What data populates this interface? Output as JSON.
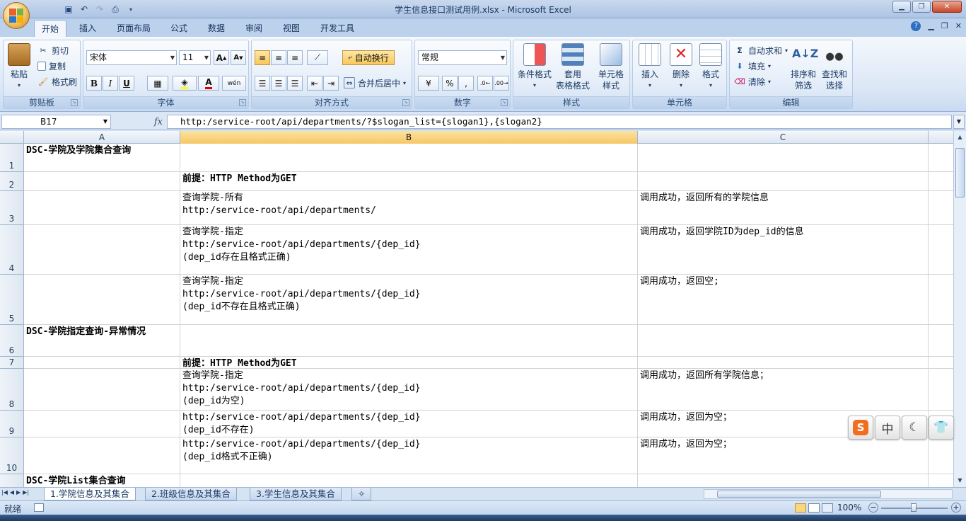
{
  "window": {
    "title": "学生信息接口测试用例.xlsx - Microsoft Excel"
  },
  "tabs": [
    {
      "label": "开始",
      "active": true
    },
    {
      "label": "插入"
    },
    {
      "label": "页面布局"
    },
    {
      "label": "公式"
    },
    {
      "label": "数据"
    },
    {
      "label": "审阅"
    },
    {
      "label": "视图"
    },
    {
      "label": "开发工具"
    }
  ],
  "ribbon": {
    "clipboard": {
      "label": "剪贴板",
      "paste": "粘贴",
      "cut": "剪切",
      "copy": "复制",
      "format_painter": "格式刷"
    },
    "font": {
      "label": "字体",
      "font_name": "宋体",
      "font_size": "11",
      "bold": "B",
      "italic": "I",
      "underline": "U",
      "grow": "A",
      "shrink": "A",
      "font_color": "A",
      "phonetic": "wén"
    },
    "alignment": {
      "label": "对齐方式",
      "wrap_text": "自动换行",
      "merge_center": "合并后居中"
    },
    "number": {
      "label": "数字",
      "format": "常规",
      "percent": "%",
      "comma": ","
    },
    "styles": {
      "label": "样式",
      "conditional": "条件格式",
      "table_style_1": "套用",
      "table_style_2": "表格格式",
      "cell_style_1": "单元格",
      "cell_style_2": "样式"
    },
    "cells": {
      "label": "单元格",
      "insert": "插入",
      "delete": "删除",
      "format": "格式"
    },
    "editing": {
      "label": "编辑",
      "autosum": "自动求和",
      "fill": "填充",
      "clear": "清除",
      "sort_1": "排序和",
      "sort_2": "筛选",
      "find_1": "查找和",
      "find_2": "选择"
    }
  },
  "formula_bar": {
    "name_box": "B17",
    "fx": "fx",
    "content": "http:/service-root/api/departments/?$slogan_list={slogan1},{slogan2}"
  },
  "columns": [
    "A",
    "B",
    "C"
  ],
  "rows": [
    {
      "num": "1",
      "a": "DSC-学院及学院集合查询",
      "b": "",
      "c": "",
      "bold_a": true
    },
    {
      "num": "2",
      "a": "",
      "b": "前提：HTTP Method为GET",
      "c": "",
      "bold_b": true
    },
    {
      "num": "3",
      "a": "",
      "b": "查询学院-所有\nhttp:/service-root/api/departments/",
      "c": "调用成功，返回所有的学院信息"
    },
    {
      "num": "4",
      "a": "",
      "b": "查询学院-指定\nhttp:/service-root/api/departments/{dep_id}\n(dep_id存在且格式正确)",
      "c": "调用成功，返回学院ID为dep_id的信息"
    },
    {
      "num": "5",
      "a": "",
      "b": "查询学院-指定\nhttp:/service-root/api/departments/{dep_id}\n(dep_id不存在且格式正确)",
      "c": "调用成功，返回空;"
    },
    {
      "num": "6",
      "a": "DSC-学院指定查询-异常情况",
      "b": "",
      "c": "",
      "bold_a": true
    },
    {
      "num": "7",
      "a": "",
      "b": "前提：HTTP Method为GET",
      "c": "",
      "bold_b": true
    },
    {
      "num": "8",
      "a": "",
      "b": "查询学院-指定\nhttp:/service-root/api/departments/{dep_id}\n(dep_id为空)",
      "c": "调用成功，返回所有学院信息；"
    },
    {
      "num": "9",
      "a": "",
      "b": "http:/service-root/api/departments/{dep_id}\n(dep_id不存在)",
      "c": "调用成功，返回为空；"
    },
    {
      "num": "10",
      "a": "",
      "b": "http:/service-root/api/departments/{dep_id}\n(dep_id格式不正确)",
      "c": "调用成功，返回为空；"
    },
    {
      "num": "",
      "a": "DSC-学院List集合查询",
      "b": "",
      "c": "",
      "bold_a": true
    }
  ],
  "sheets": [
    {
      "label": "1.学院信息及其集合",
      "active": true
    },
    {
      "label": "2.班级信息及其集合"
    },
    {
      "label": "3.学生信息及其集合"
    }
  ],
  "status": {
    "ready": "就绪",
    "zoom": "100%"
  },
  "ime": {
    "chinese": "中"
  },
  "colors": {
    "accent": "#f6c866",
    "ribbon_bg": "#dbe7f6"
  }
}
